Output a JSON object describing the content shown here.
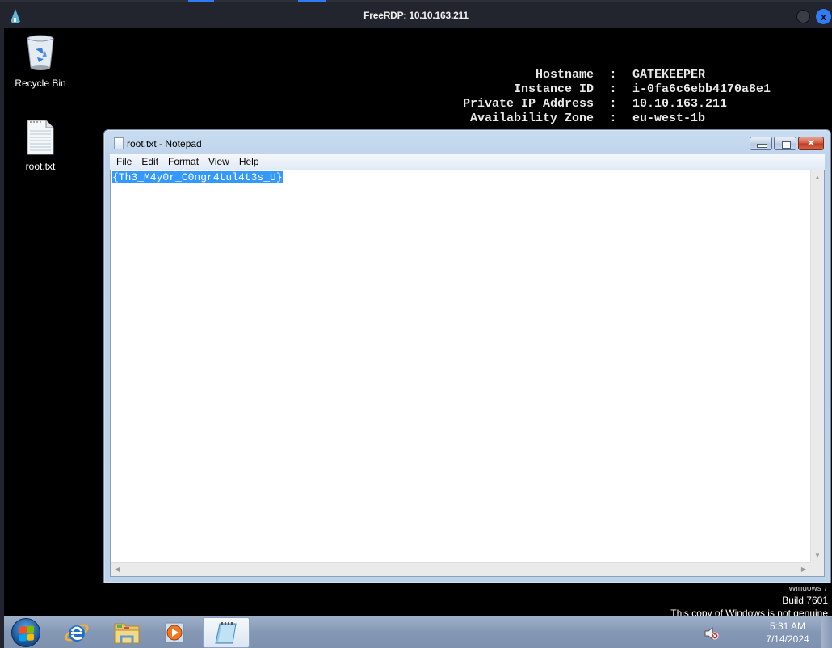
{
  "rdp_window": {
    "title": "FreeRDP: 10.10.163.211",
    "icons": {
      "logo": "freerdp-logo-icon",
      "minimize": "circle-minimize-icon",
      "close": "close-icon"
    },
    "accent_color": "#2f7cf6"
  },
  "desktop": {
    "icons": [
      {
        "label": "Recycle Bin",
        "icon": "recycle-bin-icon"
      },
      {
        "label": "root.txt",
        "icon": "text-file-icon"
      }
    ],
    "sysinfo": [
      {
        "key": "Hostname",
        "sep": ":",
        "value": "GATEKEEPER"
      },
      {
        "key": "Instance ID",
        "sep": ":",
        "value": "i-0fa6c6ebb4170a8e1"
      },
      {
        "key": "Private IP Address",
        "sep": ":",
        "value": "10.10.163.211"
      },
      {
        "key": "Availability Zone",
        "sep": ":",
        "value": "eu-west-1b"
      }
    ],
    "watermark": {
      "line0": "Windows 7",
      "line1": "Build 7601",
      "line2": "This copy of Windows is not genuine"
    }
  },
  "notepad": {
    "title": "root.txt - Notepad",
    "menu": [
      "File",
      "Edit",
      "Format",
      "View",
      "Help"
    ],
    "content": "{Th3_M4y0r_C0ngr4tul4t3s_U}",
    "content_selected": true,
    "caption_buttons": {
      "minimize": "minimize-icon",
      "maximize": "maximize-icon",
      "close": "close-icon"
    }
  },
  "taskbar": {
    "start_icon": "windows-start-icon",
    "apps": [
      {
        "name": "Internet Explorer",
        "icon": "internet-explorer-icon",
        "active": false
      },
      {
        "name": "Windows Explorer",
        "icon": "folder-icon",
        "active": false
      },
      {
        "name": "Windows Media Player",
        "icon": "media-player-icon",
        "active": false
      },
      {
        "name": "Notepad",
        "icon": "notepad-icon",
        "active": true
      }
    ],
    "tray": {
      "volume_icon": "speaker-muted-icon",
      "time": "5:31 AM",
      "date": "7/14/2024"
    }
  }
}
